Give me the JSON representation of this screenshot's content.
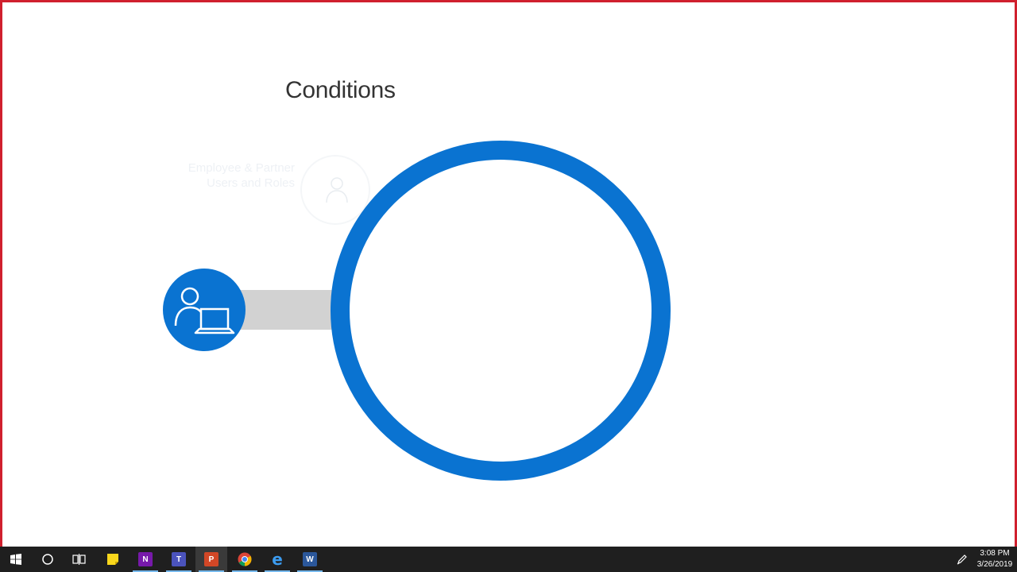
{
  "slide": {
    "title": "Conditions",
    "faded_label": "Employee & Partner Users and Roles",
    "colors": {
      "accent": "#0a73d1",
      "connector": "#d2d2d2",
      "border": "#d0202e"
    },
    "icons": {
      "faded": "user-icon",
      "main": "user-laptop-icon",
      "ring": "large-circle-ring"
    }
  },
  "taskbar": {
    "items": [
      {
        "name": "start-button",
        "icon": "windows-logo-icon"
      },
      {
        "name": "search-button",
        "icon": "cortana-circle-icon"
      },
      {
        "name": "task-view-button",
        "icon": "task-view-icon"
      },
      {
        "name": "sticky-notes-app",
        "icon": "sticky-notes-icon"
      },
      {
        "name": "onenote-app",
        "icon": "onenote-icon",
        "label": "N"
      },
      {
        "name": "teams-app",
        "icon": "teams-icon",
        "label": "T"
      },
      {
        "name": "powerpoint-app",
        "icon": "powerpoint-icon",
        "label": "P"
      },
      {
        "name": "chrome-app",
        "icon": "chrome-icon"
      },
      {
        "name": "edge-app",
        "icon": "edge-icon",
        "label": "e"
      },
      {
        "name": "word-app",
        "icon": "word-icon",
        "label": "W"
      }
    ],
    "tray_icon": "pen-icon",
    "clock": {
      "time": "3:08 PM",
      "date": "3/26/2019"
    }
  }
}
